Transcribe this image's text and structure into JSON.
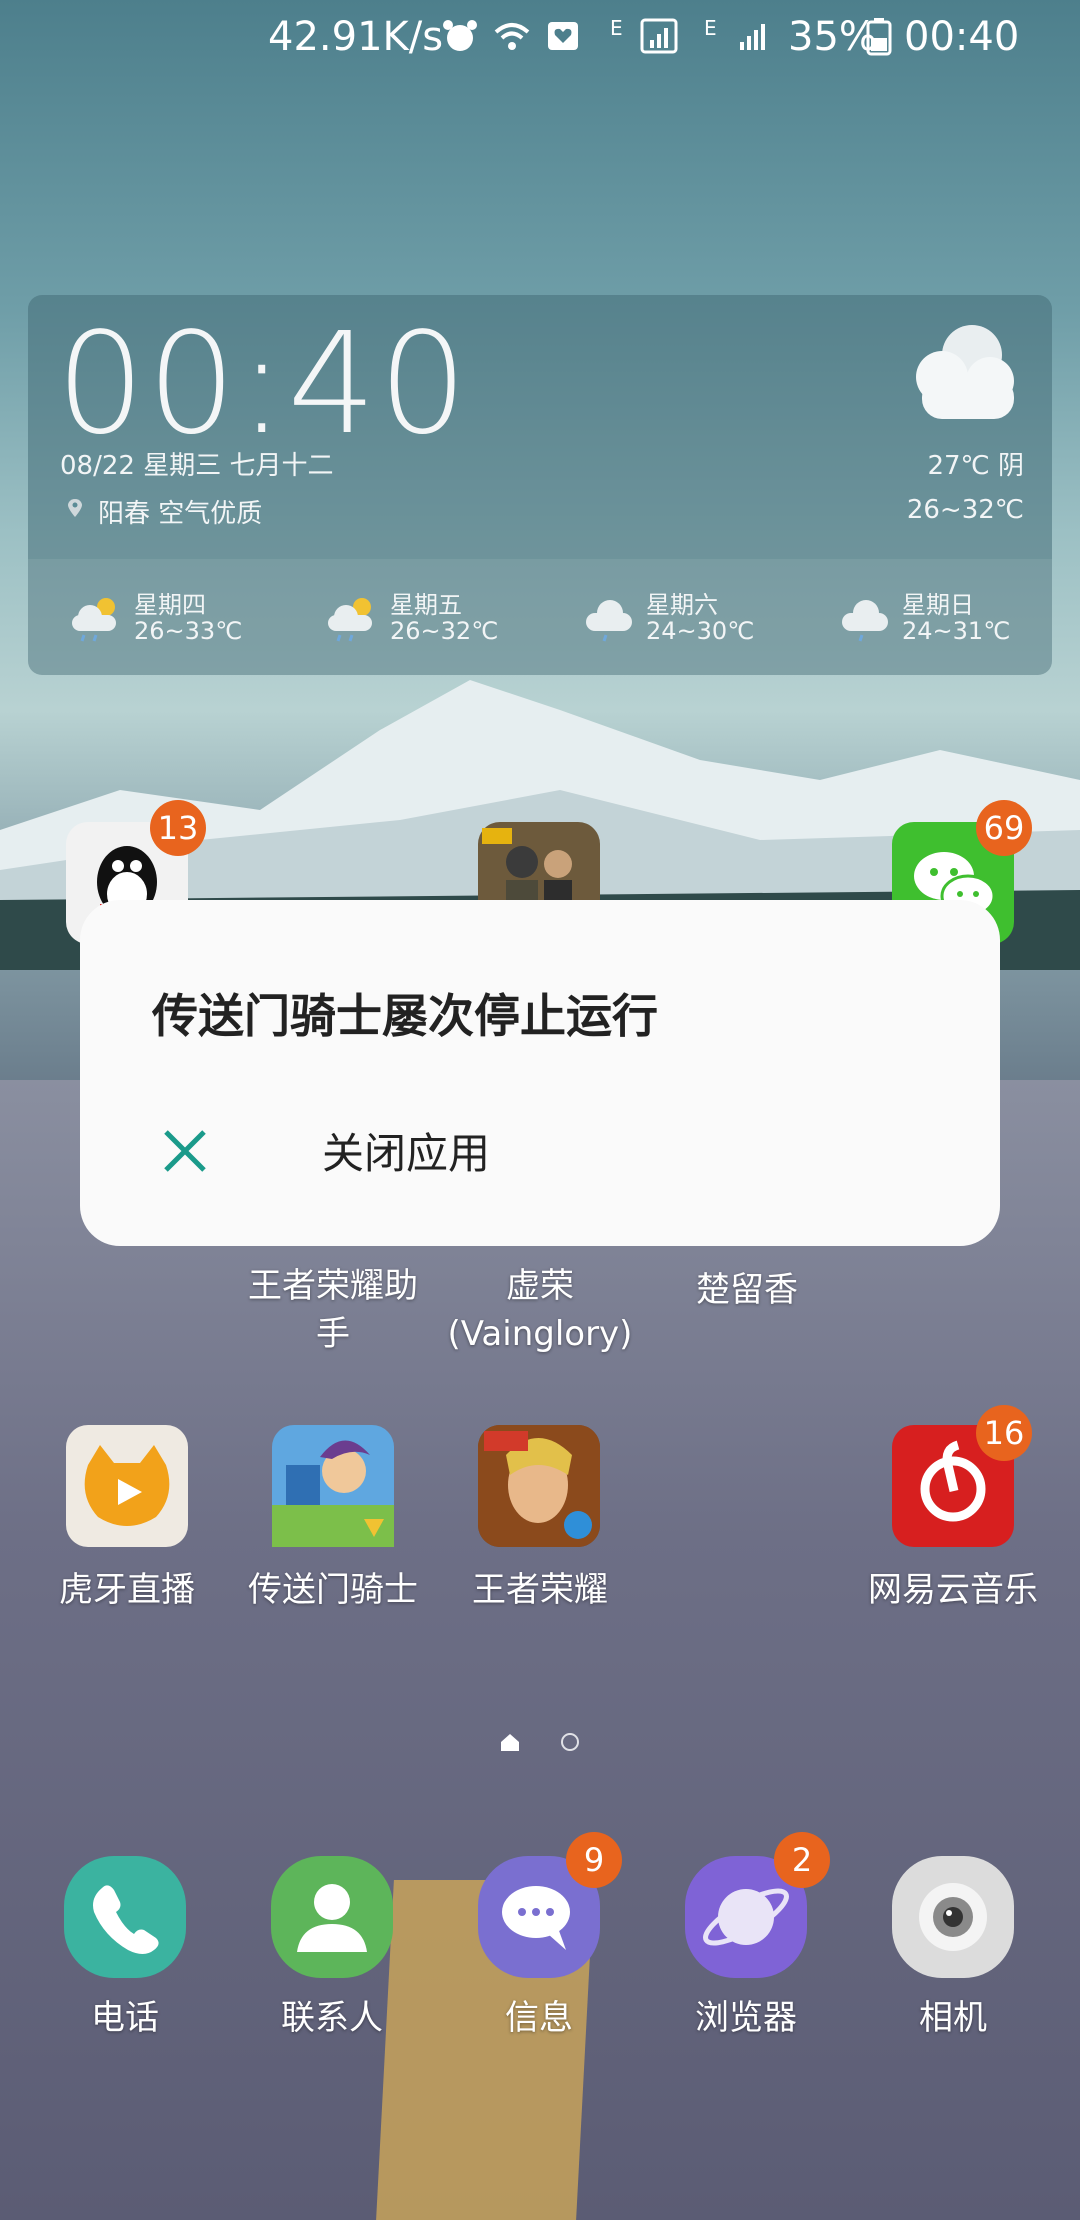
{
  "status_bar": {
    "net_speed": "42.91K/s",
    "network_1": "E",
    "network_2": "E",
    "battery": "35%",
    "time": "00:40"
  },
  "widget": {
    "clock": "00:40",
    "date": "08/22 星期三 七月十二",
    "location": "阳春 空气优质",
    "current": "27℃ 阴",
    "range": "26~32℃",
    "forecast": [
      {
        "day": "星期四",
        "range": "26~33℃",
        "icon": "sun-cloud-rain-icon"
      },
      {
        "day": "星期五",
        "range": "26~32℃",
        "icon": "sun-cloud-rain-icon"
      },
      {
        "day": "星期六",
        "range": "24~30℃",
        "icon": "cloud-rain-icon"
      },
      {
        "day": "星期日",
        "range": "24~31℃",
        "icon": "cloud-rain-icon"
      }
    ]
  },
  "apps_row1_badges": {
    "qq": "13",
    "wechat": "69"
  },
  "apps_row2": {
    "label1": "王者荣耀助\n手",
    "label2": "虚荣\n(Vainglory)",
    "label3": "楚留香"
  },
  "apps_row3": [
    {
      "label": "虎牙直播"
    },
    {
      "label": "传送门骑士"
    },
    {
      "label": "王者荣耀"
    },
    {
      "label": "网易云音乐",
      "badge": "16"
    }
  ],
  "dock": [
    {
      "label": "电话"
    },
    {
      "label": "联系人"
    },
    {
      "label": "信息",
      "badge": "9"
    },
    {
      "label": "浏览器",
      "badge": "2"
    },
    {
      "label": "相机"
    }
  ],
  "dialog": {
    "title": "传送门骑士屡次停止运行",
    "close_label": "关闭应用"
  },
  "colors": {
    "badge": "#e8641e",
    "dialog_accent": "#1a9a8a"
  }
}
